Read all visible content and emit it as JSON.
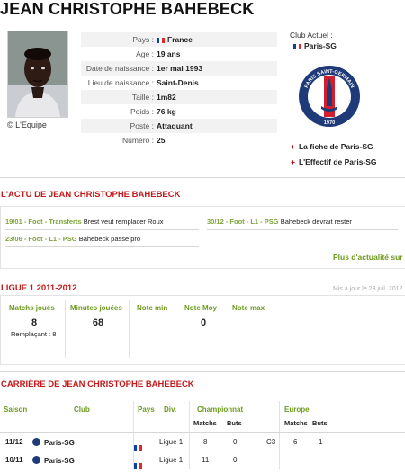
{
  "player": {
    "name": "JEAN CHRISTOPHE BAHEBECK",
    "photo_credit": "© L'Equipe",
    "fields": [
      {
        "label": "Pays :",
        "value": "France",
        "flag": "france"
      },
      {
        "label": "Age :",
        "value": "19 ans"
      },
      {
        "label": "Date de naissance :",
        "value": "1er mai 1993"
      },
      {
        "label": "Lieu de naissance :",
        "value": "Saint-Denis"
      },
      {
        "label": "Taille :",
        "value": "1m82"
      },
      {
        "label": "Poids :",
        "value": "76 kg"
      },
      {
        "label": "Poste :",
        "value": "Attaquant"
      },
      {
        "label": "Numero :",
        "value": "25"
      }
    ]
  },
  "club": {
    "heading": "Club Actuel :",
    "name": "Paris-SG",
    "crest_top": "PARIS SAINT-GERMAIN",
    "crest_year": "1970",
    "links": [
      "La fiche de Paris-SG",
      "L'Effectif de Paris-SG"
    ]
  },
  "colors": {
    "accent_red": "#c21a1a",
    "accent_green": "#6c9a1e",
    "psg_blue": "#1e3a78"
  },
  "actu": {
    "title": "L'ACTU DE JEAN CHRISTOPHE BAHEBECK",
    "left": [
      {
        "tag": "19/01 - Foot - Transferts",
        "text": "Brest veut remplacer Roux"
      },
      {
        "tag": "23/06 - Foot - L1 - PSG",
        "text": "Bahebeck passe pro"
      }
    ],
    "right": [
      {
        "tag": "30/12 - Foot - L1 - PSG",
        "text": "Bahebeck devrait rester"
      }
    ],
    "more": "Plus d'actualité sur"
  },
  "season": {
    "title": "LIGUE 1 2011-2012",
    "updated": "Mis à jour le 23 juil. 2012",
    "headers": [
      "Matchs joués",
      "Minutes jouées",
      "Note min",
      "Note Moy",
      "Note max"
    ],
    "values": [
      "8",
      "68",
      "",
      "0",
      ""
    ],
    "sub": "Remplaçant : 8"
  },
  "career": {
    "title": "CARRIÈRE DE JEAN CHRISTOPHE BAHEBECK",
    "headers": {
      "saison": "Saison",
      "club": "Club",
      "pays": "Pays",
      "div": "Div.",
      "championnat": "Championnat",
      "europe": "Europe",
      "matchs": "Matchs",
      "buts": "Buts"
    },
    "rows": [
      {
        "saison": "11/12",
        "club": "Paris-SG",
        "div": "Ligue 1",
        "matchs": "8",
        "buts": "0",
        "euro_comp": "C3",
        "euro_matchs": "6",
        "euro_buts": "1"
      },
      {
        "saison": "10/11",
        "club": "Paris-SG",
        "div": "Ligue 1",
        "matchs": "11",
        "buts": "0",
        "euro_comp": "",
        "euro_matchs": "",
        "euro_buts": ""
      }
    ]
  }
}
